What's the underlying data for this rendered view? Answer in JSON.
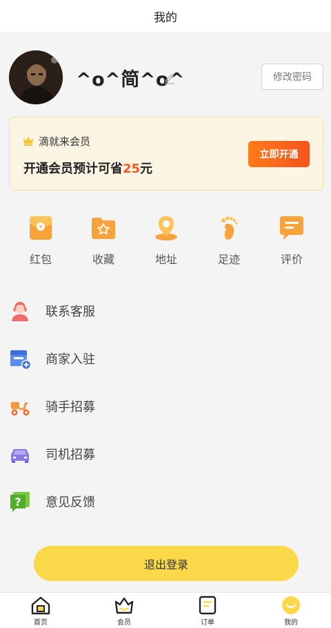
{
  "header": {
    "title": "我的"
  },
  "profile": {
    "nickname": "^o^简^o^",
    "change_password_label": "修改密码"
  },
  "vip": {
    "title": "滴就来会员",
    "text_prefix": "开通会员预计可省",
    "amount": "25",
    "text_suffix": "元",
    "button_label": "立即开通"
  },
  "quick_actions": [
    {
      "label": "红包",
      "icon": "red-envelope-icon"
    },
    {
      "label": "收藏",
      "icon": "favorites-folder-icon"
    },
    {
      "label": "地址",
      "icon": "location-pin-icon"
    },
    {
      "label": "足迹",
      "icon": "footprint-icon"
    },
    {
      "label": "评价",
      "icon": "review-chat-icon"
    }
  ],
  "menu": [
    {
      "label": "联系客服",
      "icon": "customer-service-icon"
    },
    {
      "label": "商家入驻",
      "icon": "merchant-store-icon"
    },
    {
      "label": "骑手招募",
      "icon": "rider-scooter-icon"
    },
    {
      "label": "司机招募",
      "icon": "driver-car-icon"
    },
    {
      "label": "意见反馈",
      "icon": "feedback-question-icon"
    }
  ],
  "logout_label": "退出登录",
  "tabbar": [
    {
      "label": "首页",
      "icon": "home-icon"
    },
    {
      "label": "会员",
      "icon": "vip-basket-icon"
    },
    {
      "label": "订单",
      "icon": "order-list-icon"
    },
    {
      "label": "我的",
      "icon": "profile-face-icon",
      "active": true
    }
  ],
  "colors": {
    "accent_orange": "#f4541e",
    "icon_orange": "#f7a23b",
    "vip_bg": "#fdf5e3",
    "logout_yellow": "#fbd84a"
  }
}
